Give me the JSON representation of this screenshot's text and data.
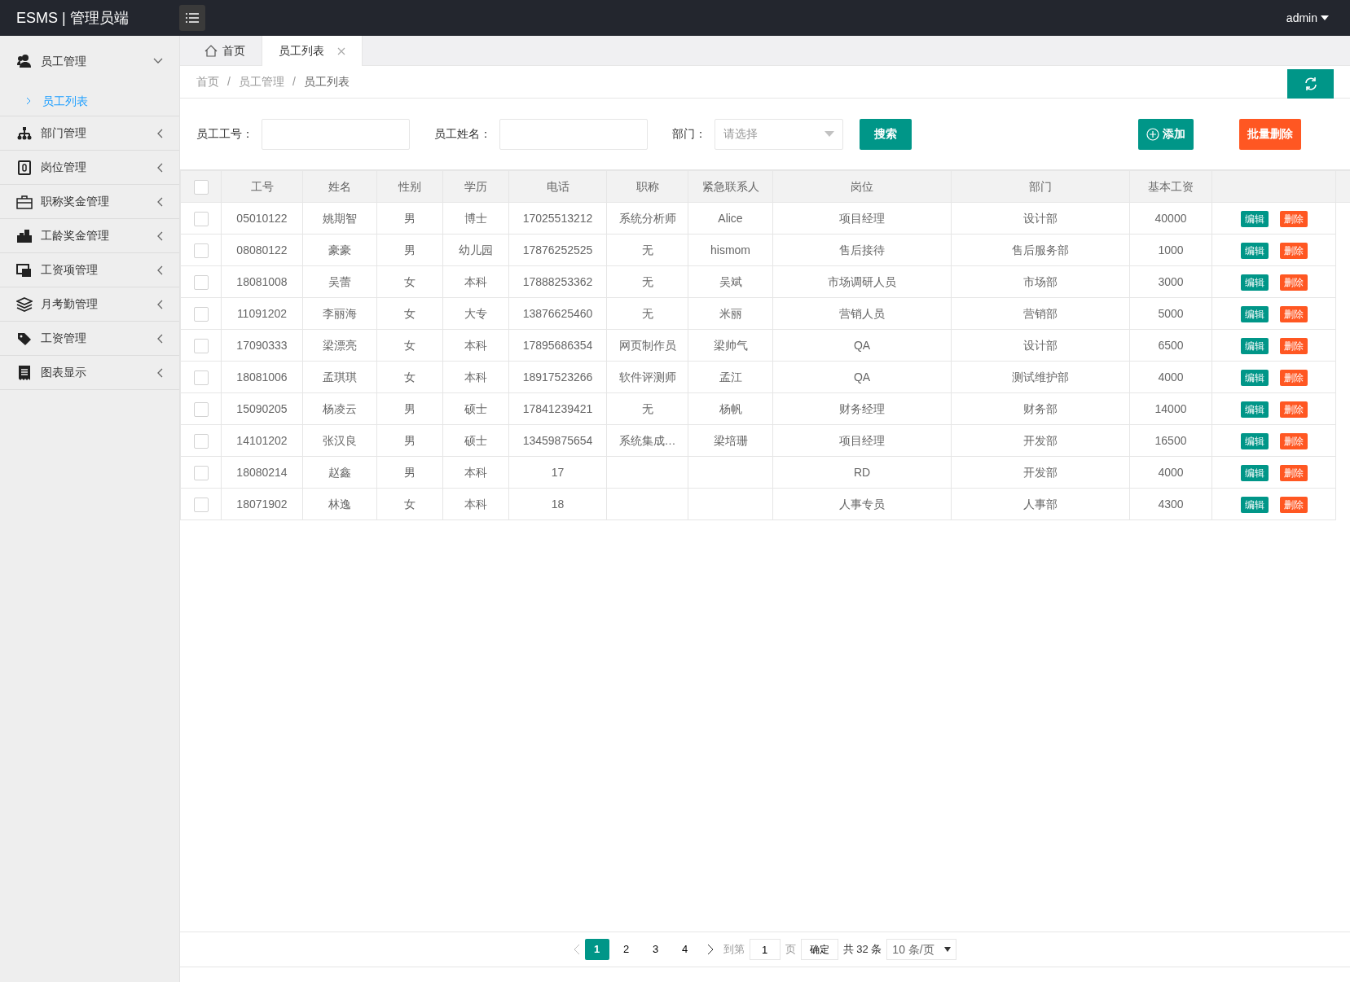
{
  "topbar": {
    "brand": "ESMS | 管理员端",
    "user": "admin"
  },
  "sidebar": [
    {
      "label": "员工管理",
      "expanded": true,
      "children": [
        {
          "label": "员工列表",
          "selected": true
        }
      ]
    },
    {
      "label": "部门管理",
      "expanded": false
    },
    {
      "label": "岗位管理",
      "expanded": false
    },
    {
      "label": "职称奖金管理",
      "expanded": false
    },
    {
      "label": "工龄奖金管理",
      "expanded": false
    },
    {
      "label": "工资项管理",
      "expanded": false
    },
    {
      "label": "月考勤管理",
      "expanded": false
    },
    {
      "label": "工资管理",
      "expanded": false
    },
    {
      "label": "图表显示",
      "expanded": false
    }
  ],
  "tabs": [
    {
      "label": "首页",
      "kind": "home",
      "selected": false
    },
    {
      "label": "员工列表",
      "kind": "closable",
      "selected": true
    }
  ],
  "breadcrumb": [
    {
      "label": "首页"
    },
    {
      "separator": "/",
      "label": "员工管理"
    },
    {
      "separator": "/",
      "label": "员工列表"
    }
  ],
  "filters": [
    {
      "label": "员工工号：",
      "kind": "text"
    },
    {
      "label": "员工姓名：",
      "kind": "text"
    },
    {
      "label": "部门：",
      "kind": "select",
      "placeholder": "请选择"
    }
  ],
  "buttons": {
    "search": "搜索",
    "add": "添加",
    "batch_delete": "批量删除"
  },
  "table": {
    "all_checked": false,
    "columns": [
      "工号",
      "姓名",
      "性别",
      "学历",
      "电话",
      "职称",
      "紧急联系人",
      "岗位",
      "部门",
      "基本工资"
    ],
    "rows": [
      {
        "checked": false,
        "cells": [
          "05010122",
          "姚期智",
          "男",
          "博士",
          "17025513212",
          "系统分析师",
          "Alice",
          "项目经理",
          "设计部",
          "40000"
        ],
        "actions": [
          "编辑",
          "删除"
        ]
      },
      {
        "checked": false,
        "cells": [
          "08080122",
          "豪豪",
          "男",
          "幼儿园",
          "17876252525",
          "无",
          "hismom",
          "售后接待",
          "售后服务部",
          "1000"
        ],
        "actions": [
          "编辑",
          "删除"
        ]
      },
      {
        "checked": false,
        "cells": [
          "18081008",
          "吴蕾",
          "女",
          "本科",
          "17888253362",
          "无",
          "吴斌",
          "市场调研人员",
          "市场部",
          "3000"
        ],
        "actions": [
          "编辑",
          "删除"
        ]
      },
      {
        "checked": false,
        "cells": [
          "11091202",
          "李丽海",
          "女",
          "大专",
          "13876625460",
          "无",
          "米丽",
          "营销人员",
          "营销部",
          "5000"
        ],
        "actions": [
          "编辑",
          "删除"
        ]
      },
      {
        "checked": false,
        "cells": [
          "17090333",
          "梁漂亮",
          "女",
          "本科",
          "17895686354",
          "网页制作员",
          "梁帅气",
          "QA",
          "设计部",
          "6500"
        ],
        "actions": [
          "编辑",
          "删除"
        ]
      },
      {
        "checked": false,
        "cells": [
          "18081006",
          "孟琪琪",
          "女",
          "本科",
          "18917523266",
          "软件评测师",
          "孟江",
          "QA",
          "测试维护部",
          "4000"
        ],
        "actions": [
          "编辑",
          "删除"
        ]
      },
      {
        "checked": false,
        "cells": [
          "15090205",
          "杨凌云",
          "男",
          "硕士",
          "17841239421",
          "无",
          "杨帆",
          "财务经理",
          "财务部",
          "14000"
        ],
        "actions": [
          "编辑",
          "删除"
        ]
      },
      {
        "checked": false,
        "cells": [
          "14101202",
          "张汉良",
          "男",
          "硕士",
          "13459875654",
          "系统集成…",
          "梁培珊",
          "项目经理",
          "开发部",
          "16500"
        ],
        "actions": [
          "编辑",
          "删除"
        ]
      },
      {
        "checked": false,
        "cells": [
          "18080214",
          "赵鑫",
          "男",
          "本科",
          "17",
          "",
          "",
          "RD",
          "开发部",
          "4000"
        ],
        "actions": [
          "编辑",
          "删除"
        ]
      },
      {
        "checked": false,
        "cells": [
          "18071902",
          "林逸",
          "女",
          "本科",
          "18",
          "",
          "",
          "人事专员",
          "人事部",
          "4300"
        ],
        "actions": [
          "编辑",
          "删除"
        ]
      }
    ]
  },
  "pagination": {
    "pages": [
      {
        "label": "1",
        "selected": true
      },
      {
        "label": "2",
        "selected": false
      },
      {
        "label": "3",
        "selected": false
      },
      {
        "label": "4",
        "selected": false
      }
    ],
    "goto_label": "到第",
    "goto_value": "1",
    "page_unit": "页",
    "confirm": "确定",
    "total": "共 32 条",
    "page_size": "10 条/页"
  }
}
